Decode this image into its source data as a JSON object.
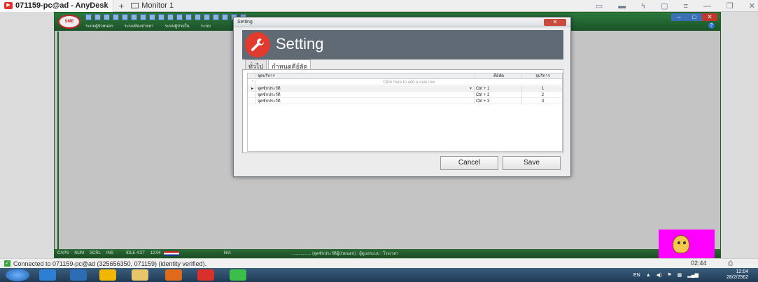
{
  "anydesk": {
    "tab_title": "071159-pc@ad - AnyDesk",
    "new_tab_symbol": "+",
    "monitor_label": "Monitor 1",
    "status_text": "Connected to 071159-pc@ad (325656350, 071159) (identity verified).",
    "status_time": "02:44"
  },
  "app": {
    "logo_text": "SME",
    "menu": [
      "ระบบผู้ป่วยนอก",
      "ระบบห้องจ่ายยา",
      "ระบบผู้ป่วยใน",
      "ระบบ"
    ],
    "status": {
      "caps": "CAPS",
      "num": "NUM",
      "scrl": "SCRL",
      "ins": "INS",
      "idle": "IDLE 4:27",
      "time": "12:04",
      "na": "N/A",
      "info": "................ (จุดซักประวัติผู้ป่วยนอก) : ผู้ดูแลระบบ : โรงเวลา"
    }
  },
  "dialog": {
    "window_title": "Setting",
    "heading": "Setting",
    "tabs": [
      {
        "label": "ทั่วไป",
        "active": false
      },
      {
        "label": "กำหนดคีย์ลัด",
        "active": true
      }
    ],
    "grid": {
      "columns": [
        "จุดบริการ",
        "คีย์ลัด",
        "จุบริการ"
      ],
      "new_row_hint": "Click here to add a new row",
      "rows": [
        {
          "service": "จุดซักประวัติ",
          "shortcut": "Ctrl + 1",
          "order": "1"
        },
        {
          "service": "จุดซักประวัติ",
          "shortcut": "Ctrl + 2",
          "order": "2"
        },
        {
          "service": "จุดซักประวัติ",
          "shortcut": "Ctrl + 3",
          "order": "3"
        }
      ]
    },
    "buttons": {
      "cancel": "Cancel",
      "save": "Save"
    }
  },
  "taskbar": {
    "language": "EN",
    "clock_time": "12:04",
    "clock_date": "28/2/2562"
  },
  "colors": {
    "dialog_header": "#5f6a74",
    "wrench_badge": "#e23b2e",
    "app_green": "#1c5128",
    "mascot_bg": "#ff00ff"
  }
}
